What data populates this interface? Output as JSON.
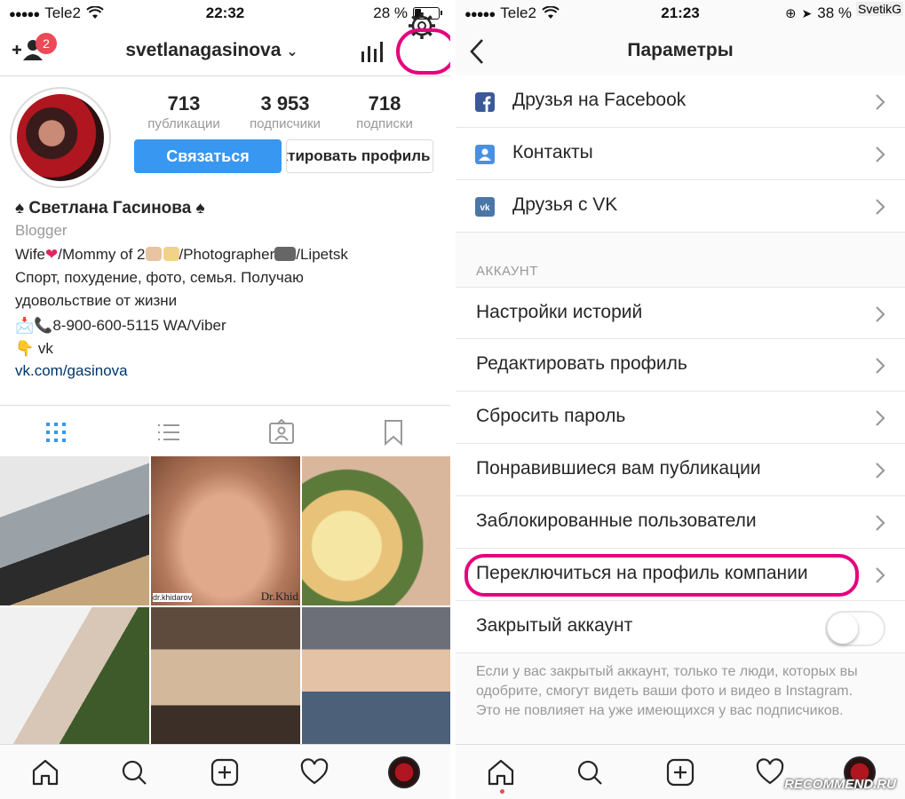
{
  "left": {
    "status": {
      "carrier": "Tele2",
      "time": "22:32",
      "battery": "28 %",
      "battery_level": 0.28
    },
    "header": {
      "username": "svetlanagasinova",
      "notif_count": "2"
    },
    "stats": [
      {
        "value": "713",
        "label": "публикации"
      },
      {
        "value": "3 953",
        "label": "подписчики"
      },
      {
        "value": "718",
        "label": "подписки"
      }
    ],
    "buttons": {
      "contact": "Связаться",
      "edit": "Редактировать профиль"
    },
    "bio": {
      "name": "♠ Светлана Гасинова ♠",
      "category": "Blogger",
      "line1_a": "Wife",
      "line1_b": "/Mommy of 2",
      "line1_c": "/Photographer",
      "line1_d": "/Lipetsk",
      "line2": "Спорт, похудение, фото, семья. Получаю",
      "line3": "удовольствие от жизни",
      "line4": "📩📞8-900-600-5115 WA/Viber",
      "line5": "👇 vk",
      "link": "vk.com/gasinova"
    },
    "photo_watermarks": {
      "p2_small": "dr.khidarov",
      "p2_big": "Dr.Khid"
    }
  },
  "right": {
    "status": {
      "carrier": "Tele2",
      "time": "21:23",
      "battery": "38 %",
      "battery_level": 0.38,
      "extra": "SvetikG"
    },
    "title": "Параметры",
    "items_top": [
      {
        "label": "Друзья на Facebook",
        "icon": "facebook-icon",
        "color": "#3b5998"
      },
      {
        "label": "Контакты",
        "icon": "contacts-icon",
        "color": "#4a90e2"
      },
      {
        "label": "Друзья с VK",
        "icon": "vk-icon",
        "color": "#4a76a8"
      }
    ],
    "section_account": "АККАУНТ",
    "items_account": [
      {
        "label": "Настройки историй"
      },
      {
        "label": "Редактировать профиль"
      },
      {
        "label": "Сбросить пароль"
      },
      {
        "label": "Понравившиеся вам публикации"
      },
      {
        "label": "Заблокированные пользователи"
      },
      {
        "label": "Переключиться на профиль компании"
      }
    ],
    "private": {
      "label": "Закрытый аккаунт",
      "enabled": false
    },
    "hint": "Если у вас закрытый аккаунт, только те люди, которых вы одобрите, смогут видеть ваши фото и видео в Instagram. Это не повлияет на уже имеющихся у вас подписчиков."
  },
  "watermark": "RECOMMEND.RU",
  "colors": {
    "accent": "#3897f0",
    "highlight": "#e6007e",
    "badge": "#ed4956"
  }
}
